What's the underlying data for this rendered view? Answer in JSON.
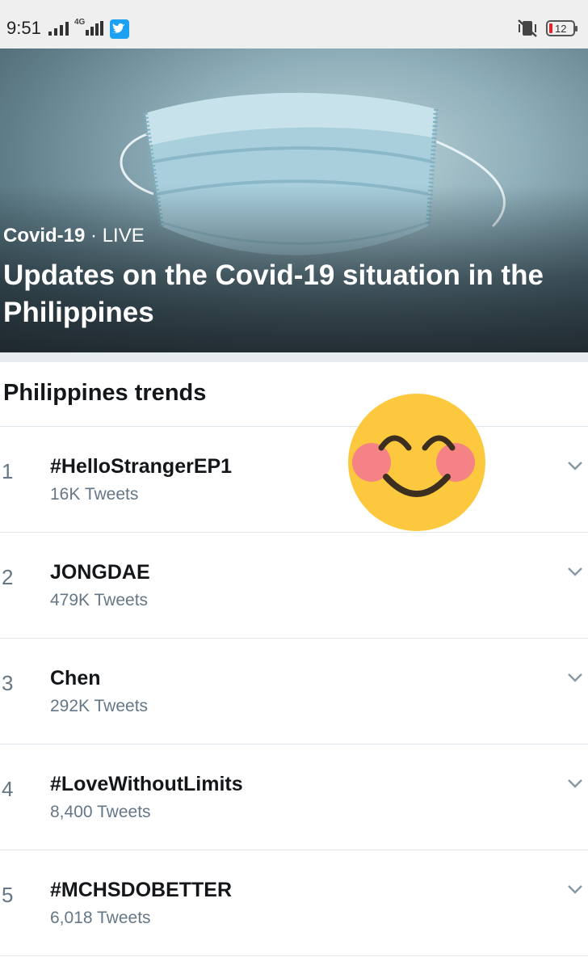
{
  "status_bar": {
    "time": "9:51",
    "network": "4G",
    "battery": "12",
    "icons": [
      "signal-icon",
      "4g-signal-icon",
      "twitter-icon",
      "vibrate-icon",
      "battery-icon"
    ]
  },
  "hero": {
    "category": "Covid-19",
    "separator": " · ",
    "status": "LIVE",
    "title": "Updates on the Covid-19 situation in the Philippines"
  },
  "trends": {
    "header": "Philippines trends",
    "items": [
      {
        "rank": "1",
        "name": "#HelloStrangerEP1",
        "count": "16K Tweets"
      },
      {
        "rank": "2",
        "name": "JONGDAE",
        "count": "479K Tweets"
      },
      {
        "rank": "3",
        "name": "Chen",
        "count": "292K Tweets"
      },
      {
        "rank": "4",
        "name": "#LoveWithoutLimits",
        "count": "8,400 Tweets"
      },
      {
        "rank": "5",
        "name": "#MCHSDOBETTER",
        "count": "6,018 Tweets"
      }
    ]
  },
  "colors": {
    "accent": "#1da1f2",
    "secondary_text": "#657786",
    "emoji_face": "#fcc93e",
    "emoji_blush": "#f47a8c"
  }
}
